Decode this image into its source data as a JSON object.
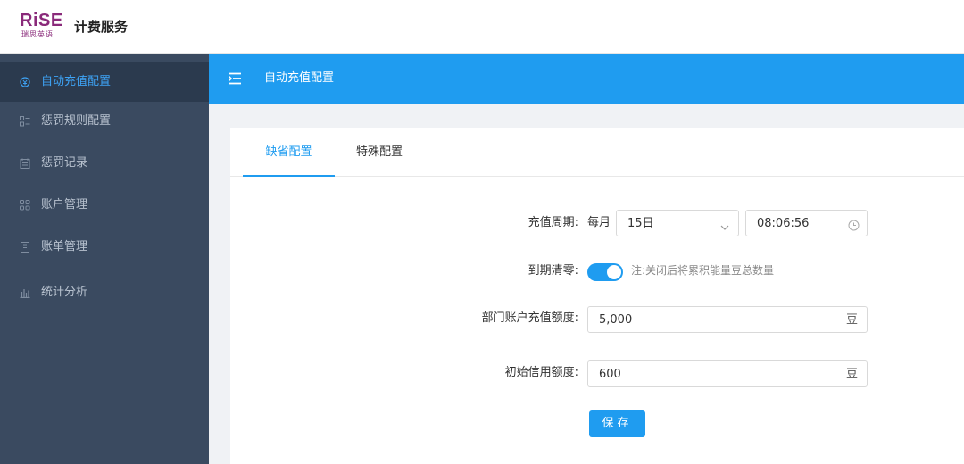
{
  "header": {
    "logo_text": "RiSE",
    "logo_sub": "瑞思英语",
    "app_title": "计费服务"
  },
  "sidebar": {
    "items": [
      {
        "label": "自动充值配置",
        "icon": "recharge-icon",
        "active": true
      },
      {
        "label": "惩罚规则配置",
        "icon": "rules-icon"
      },
      {
        "label": "惩罚记录",
        "icon": "record-icon"
      },
      {
        "label": "账户管理",
        "icon": "grid-icon"
      },
      {
        "label": "账单管理",
        "icon": "bill-icon"
      },
      {
        "label": "统计分析",
        "icon": "chart-icon"
      }
    ]
  },
  "titlebar": {
    "title": "自动充值配置",
    "icon": "menu-fold-icon"
  },
  "tabs": [
    {
      "label": "缺省配置",
      "active": true
    },
    {
      "label": "特殊配置"
    }
  ],
  "form": {
    "cycle": {
      "label": "充值周期:",
      "prefix": "每月",
      "day_value": "15日",
      "time_value": "08:06:56"
    },
    "expire": {
      "label": "到期清零:",
      "enabled": true,
      "note": "注:关闭后将累积能量豆总数量"
    },
    "dept_amount": {
      "label": "部门账户充值额度:",
      "value": "5,000",
      "unit": "豆"
    },
    "credit": {
      "label": "初始信用额度:",
      "value": "600",
      "unit": "豆"
    },
    "save_label": "保存"
  },
  "colors": {
    "primary": "#1f9cf0",
    "sidebar_bg": "#3a4a60",
    "sidebar_active_bg": "#2b3a4e",
    "logo_purple": "#8a2a7a"
  }
}
